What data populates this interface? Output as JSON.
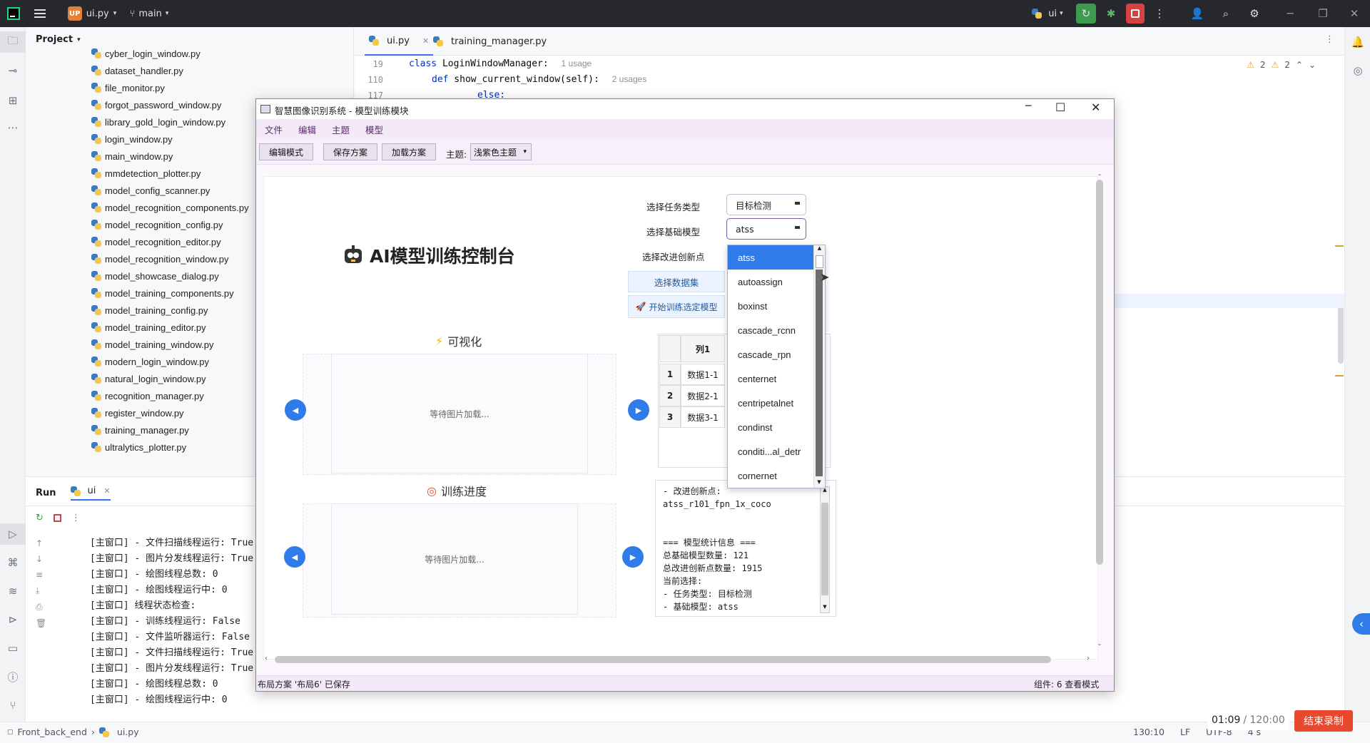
{
  "ide": {
    "project_badge": "UP",
    "project_name": "ui.py",
    "branch": "main",
    "run_config": "ui",
    "project_label": "Project",
    "files": [
      "cyber_login_window.py",
      "dataset_handler.py",
      "file_monitor.py",
      "forgot_password_window.py",
      "library_gold_login_window.py",
      "login_window.py",
      "main_window.py",
      "mmdetection_plotter.py",
      "model_config_scanner.py",
      "model_recognition_components.py",
      "model_recognition_config.py",
      "model_recognition_editor.py",
      "model_recognition_window.py",
      "model_showcase_dialog.py",
      "model_training_components.py",
      "model_training_config.py",
      "model_training_editor.py",
      "model_training_window.py",
      "modern_login_window.py",
      "natural_login_window.py",
      "recognition_manager.py",
      "register_window.py",
      "training_manager.py",
      "ultralytics_plotter.py"
    ],
    "tabs": [
      {
        "label": "ui.py"
      },
      {
        "label": "training_manager.py"
      }
    ],
    "code_lines": [
      {
        "num": "19",
        "kw": "class",
        "text": " LoginWindowManager:",
        "hint": "1 usage"
      },
      {
        "num": "110",
        "kw": "def",
        "text": " show_current_window(self):",
        "hint": "2 usages"
      },
      {
        "num": "117",
        "kw": "",
        "text": "else:",
        "hint": ""
      }
    ],
    "warnings_a": "2",
    "warnings_b": "2",
    "run_tab": "Run",
    "run_config_tab": "ui",
    "console": [
      "[主窗口] - 文件扫描线程运行: True",
      "[主窗口] - 图片分发线程运行: True",
      "[主窗口] - 绘图线程总数: 0",
      "[主窗口] - 绘图线程运行中: 0",
      "[主窗口] 线程状态检查:",
      "[主窗口] - 训练线程运行: False",
      "[主窗口] - 文件监听器运行: False",
      "[主窗口] - 文件扫描线程运行: True",
      "[主窗口] - 图片分发线程运行: True",
      "[主窗口] - 绘图线程总数: 0",
      "[主窗口] - 绘图线程运行中: 0"
    ],
    "status": {
      "breadcrumb_root": "Front_back_end",
      "breadcrumb_file": "ui.py",
      "position": "130:10",
      "line_sep": "LF",
      "encoding": "UTF-8",
      "indent": "4 s"
    }
  },
  "recording": {
    "elapsed": "01:09",
    "total": "/ 120:00",
    "stop_label": "结束录制"
  },
  "app": {
    "title": "智慧图像识别系统 - 模型训练模块",
    "menu": [
      "文件",
      "编辑",
      "主题",
      "模型"
    ],
    "toolbar": {
      "edit_mode": "编辑模式",
      "save_scheme": "保存方案",
      "load_scheme": "加载方案",
      "theme_label": "主题:",
      "theme_value": "浅紫色主题"
    },
    "heading": "AI模型训练控制台",
    "task_type_label": "选择任务类型",
    "task_type_value": "目标检测",
    "base_model_label": "选择基础模型",
    "base_model_value": "atss",
    "innovation_label": "选择改进创新点",
    "dataset_button": "选择数据集",
    "start_button": "开始训练选定模型",
    "visual_title": "可视化",
    "progress_title": "训练进度",
    "waiting_text_1": "等待图片加载...",
    "waiting_text_2": "等待图片加载...",
    "table": {
      "header": "列1",
      "rows": [
        {
          "num": "1",
          "val": "数据1-1"
        },
        {
          "num": "2",
          "val": "数据2-1"
        },
        {
          "num": "3",
          "val": "数据3-1"
        }
      ]
    },
    "dropdown_items": [
      "atss",
      "autoassign",
      "boxinst",
      "cascade_rcnn",
      "cascade_rpn",
      "centernet",
      "centripetalnet",
      "condinst",
      "conditi...al_detr",
      "cornernet"
    ],
    "dropdown_selected": "atss",
    "log_lines": [
      "- 改进创新点:",
      "atss_r101_fpn_1x_coco",
      "",
      "",
      "=== 模型统计信息 ===",
      "总基础模型数量: 121",
      "总改进创新点数量: 1915",
      "当前选择:",
      "- 任务类型: 目标检测",
      "- 基础模型: atss"
    ],
    "status_left": "布局方案 '布局6' 已保存",
    "status_right": "组件: 6  查看模式"
  }
}
